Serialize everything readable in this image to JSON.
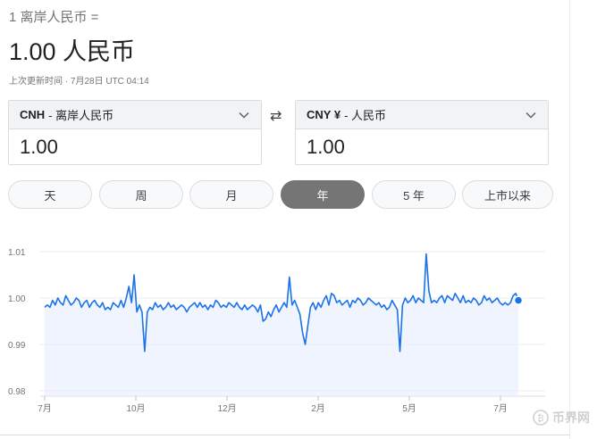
{
  "header": {
    "subtitle": "1 离岸人民币 =",
    "amount": "1.00 人民币",
    "updated": "上次更新时间 · 7月28日 UTC 04:14"
  },
  "from": {
    "code": "CNH",
    "name": " - 离岸人民币",
    "value": "1.00"
  },
  "to": {
    "code": "CNY ¥",
    "name": " - 人民币",
    "value": "1.00"
  },
  "swap_icon": "⇄",
  "tabs": [
    {
      "label": "天",
      "active": false
    },
    {
      "label": "周",
      "active": false
    },
    {
      "label": "月",
      "active": false
    },
    {
      "label": "年",
      "active": true
    },
    {
      "label": "5 年",
      "active": false
    },
    {
      "label": "上市以来",
      "active": false
    }
  ],
  "watermark": "币界网",
  "colors": {
    "line": "#1a73e8",
    "fill": "#e8f0fe",
    "active_tab": "#757575"
  },
  "chart_data": {
    "type": "area",
    "x_ticks": [
      "7月",
      "10月",
      "12月",
      "2月",
      "5月",
      "7月"
    ],
    "y_ticks": [
      "1.01",
      "1.00",
      "0.99",
      "0.98"
    ],
    "ylim": [
      0.979,
      1.011
    ],
    "grid": true,
    "series": [
      {
        "values": [
          0.998,
          0.9985,
          0.998,
          0.9995,
          0.9985,
          1.0,
          0.999,
          0.9985,
          1.0005,
          0.9995,
          0.9985,
          0.999,
          1.0,
          0.9995,
          0.998,
          0.999,
          0.9995,
          0.998,
          0.999,
          0.9995,
          0.9985,
          0.998,
          0.999,
          0.9975,
          0.998,
          0.9975,
          0.999,
          0.9985,
          0.998,
          0.9995,
          0.998,
          1.0,
          1.0025,
          0.999,
          1.005,
          0.997,
          0.9985,
          0.997,
          0.9885,
          0.997,
          0.998,
          0.9975,
          0.999,
          0.998,
          0.9985,
          0.9975,
          0.998,
          0.999,
          0.998,
          0.9985,
          0.9975,
          0.998,
          0.9985,
          0.998,
          0.997,
          0.998,
          0.9985,
          0.999,
          0.998,
          0.999,
          0.998,
          0.9985,
          0.9975,
          0.9985,
          0.998,
          0.9995,
          0.999,
          0.998,
          0.9985,
          0.998,
          0.999,
          0.9985,
          0.998,
          0.999,
          0.998,
          0.9975,
          0.9985,
          0.9975,
          0.998,
          0.9985,
          0.998,
          0.997,
          0.9985,
          0.995,
          0.9955,
          0.997,
          0.996,
          0.9975,
          0.9985,
          0.997,
          0.998,
          0.999,
          0.998,
          1.0045,
          0.9985,
          0.9995,
          0.998,
          0.9965,
          0.9925,
          0.99,
          0.994,
          0.998,
          0.999,
          0.9975,
          0.999,
          0.998,
          0.9995,
          1.0005,
          0.9985,
          1.001,
          1.0005,
          0.999,
          0.9995,
          0.9985,
          0.999,
          0.9995,
          0.998,
          0.9995,
          0.999,
          1.0,
          0.9995,
          0.9985,
          0.999,
          1.0,
          0.9995,
          0.999,
          0.9985,
          0.999,
          0.998,
          0.9985,
          0.9975,
          0.998,
          0.9995,
          0.9985,
          0.9975,
          0.9885,
          0.9985,
          1.0,
          0.999,
          0.9995,
          1.0005,
          0.999,
          1.0,
          0.9995,
          0.999,
          1.0095,
          1.0015,
          0.999,
          0.9995,
          0.999,
          1.0,
          1.0005,
          0.999,
          1.0005,
          1.0,
          0.9995,
          1.001,
          1.0,
          0.999,
          1.0005,
          0.999,
          0.9995,
          0.999,
          1.0,
          0.9995,
          0.9985,
          0.999,
          1.0005,
          0.9995,
          1.0,
          0.999,
          0.9995,
          1.0,
          0.999,
          0.9985,
          0.999,
          0.9985,
          0.999,
          1.0005,
          1.001,
          0.9995
        ]
      }
    ]
  }
}
